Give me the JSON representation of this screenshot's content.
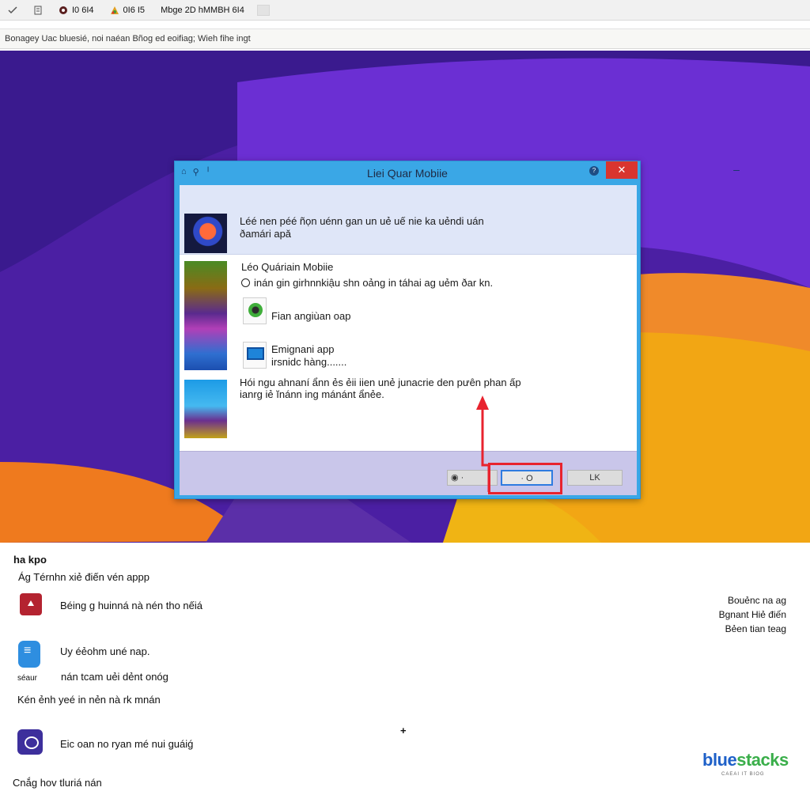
{
  "tabs": [
    {
      "icon": "check-icon",
      "label": ""
    },
    {
      "icon": "page-icon",
      "label": ""
    },
    {
      "icon": "record-icon",
      "label": "I0 6I4"
    },
    {
      "icon": "colorful-icon",
      "label": "0I6 I5"
    },
    {
      "icon": "",
      "label": "Mbge 2D hMMBH 6I4"
    }
  ],
  "url_text": "Bonagey Uac bluesié, noi naéan Bñog ed eoifiag; Wieh fihe ingt",
  "colors": {
    "dialog_frame": "#3aa7e6",
    "close": "#d9352f",
    "highlight": "#e8232e",
    "logo_blue": "#1e60c8",
    "logo_green": "#3aae4a"
  },
  "dialog": {
    "title": "Liei Quar Mobiie",
    "row1_text_line1": "Léé nen péé ñọn uénn gan un uẻ uế nie ka uẻndi uán",
    "row1_text_line2": "ðamári apǎ",
    "title2": "Léo Quáriain Mobiie",
    "radio_text": "inán gin girhnnkiậu shn oảng in táhai ag uẻm ðar kn.",
    "option1_label": "Fian angiùan oap",
    "option2_label_line1": "Emignani app",
    "option2_label_line2": "irsnidc hàng.......",
    "desc_line1": "Hói ngu ahnaní ẩnn ẻs ẻii iien unẻ junacrie den pưên phan ấp",
    "desc_line2": "ianrg iẻ ĭnánn ing mánánt ẩnẻe.",
    "btn_a": "",
    "btn_b": "",
    "btn_c": "O",
    "btn_d": "LK"
  },
  "bottom": {
    "heading": "ha kpo",
    "line1": "Ág Térnhn xiẻ điến vén appp",
    "line2": "Béing g huinná nà nén tho nếiá",
    "line3": "Uy éẻohm uné nap.",
    "icon2_caption": "séaur",
    "line4": "nán tcam uẻi dẻnt onóg",
    "line5": "Kén ẻnh yeé in nẻn nà rk mnán",
    "line6": "Eic oan no ryan mé nui guáiǵ",
    "line7": "Cnắg hov tluriá nán",
    "plus": "+",
    "right1": "Bouẻnc na ag",
    "right2": "Bgnant Hiẻ điến",
    "right3": "Bẻen tian teag",
    "logo_part1": "blue",
    "logo_part2": "stacks",
    "logo_sub": "CAEAI IT BIOG"
  }
}
